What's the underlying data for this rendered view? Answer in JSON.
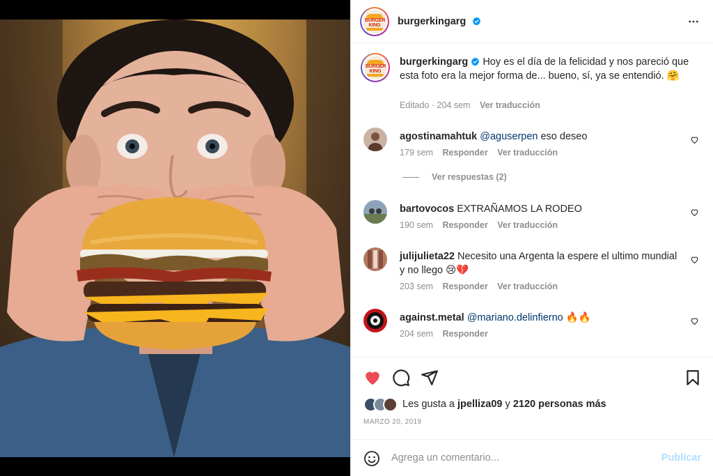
{
  "post": {
    "author": "burgerkingarg",
    "logo_text": "BURGER KING",
    "caption": "Hoy es el día de la felicidad y nos pareció que esta foto era la mejor forma de... bueno, sí, ya se entendió. 🤗",
    "edited": "Editado",
    "age": "204 sem",
    "translate": "Ver traducción",
    "likes_prefix": "Les gusta a",
    "likes_user": "jpelliza09",
    "likes_mid": "y",
    "likes_count": "2120 personas más",
    "date": "MARZO 20, 2019"
  },
  "comments": [
    {
      "user": "agostinamahtuk",
      "mention": "@aguserpen",
      "text": " eso deseo",
      "age": "179 sem",
      "reply": "Responder",
      "translate": "Ver traducción",
      "avatar_color": "#c9b2a4"
    },
    {
      "user": "bartovocos",
      "mention": "",
      "text": "EXTRAÑAMOS LA RODEO",
      "age": "190 sem",
      "reply": "Responder",
      "translate": "Ver traducción",
      "avatar_color": "#8ea3b8"
    },
    {
      "user": "julijulieta22",
      "mention": "",
      "text": "Necesito una Argenta la espere el ultimo mundial y no llego 😢💔",
      "age": "203 sem",
      "reply": "Responder",
      "translate": "Ver traducción",
      "avatar_color": "#b47a62"
    },
    {
      "user": "against.metal",
      "mention": "@mariano.delinfierno",
      "text": " 🔥🔥",
      "age": "204 sem",
      "reply": "Responder",
      "translate": "",
      "avatar_color": "#c0131b"
    }
  ],
  "replies_toggle": "Ver respuestas (2)",
  "composer": {
    "placeholder": "Agrega un comentario...",
    "publish": "Publicar"
  },
  "colors": {
    "accent_blue": "#0095f6",
    "liked_red": "#ed4956",
    "muted": "#8e8e8e",
    "mention": "#00376b",
    "publish_disabled": "#b2dffc"
  },
  "icons": {
    "more": "more-horizontal-icon",
    "verified": "verified-badge-icon",
    "comment_like": "heart-outline-icon",
    "like": "heart-filled-icon",
    "comment": "comment-bubble-icon",
    "share": "paper-plane-icon",
    "save": "bookmark-icon",
    "emoji": "emoji-smile-icon"
  }
}
